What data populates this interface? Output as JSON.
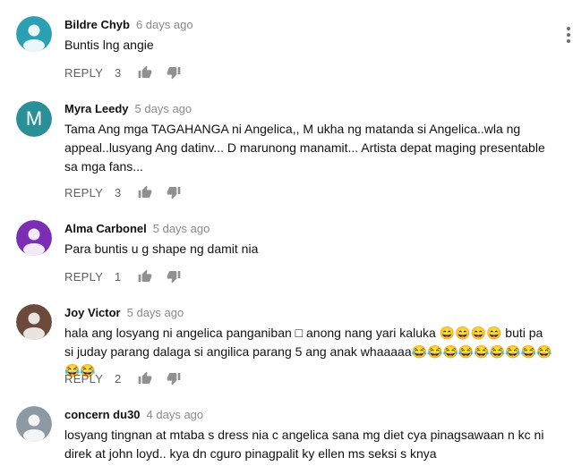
{
  "reply_label": "REPLY",
  "comments": [
    {
      "author": "Bildre Chyb",
      "time": "6 days ago",
      "text": "Buntis lng angie",
      "likes": "3",
      "avatar": {
        "type": "silhouette",
        "bg": "#2aa0b2"
      }
    },
    {
      "author": "Myra Leedy",
      "time": "5 days ago",
      "text": "Tama Ang mga TAGAHANGA ni Angelica,, M ukha ng matanda si Angelica..wla ng appeal..lusyang Ang datinv... D marunong manamit... Artista depat maging presentable sa mga fans...",
      "likes": "3",
      "avatar": {
        "type": "letter",
        "letter": "M",
        "bg": "#2a8f97"
      }
    },
    {
      "author": "Alma Carbonel",
      "time": "5 days ago",
      "text": "Para buntis u g shape ng damit nia",
      "likes": "1",
      "avatar": {
        "type": "silhouette",
        "bg": "#7b2db3"
      }
    },
    {
      "author": "Joy Victor",
      "time": "5 days ago",
      "text": "hala ang losyang ni angelica panganiban □ anong nang yari kaluka 😄😄😄😄 buti pa si juday parang dalaga si angilica parang 5 ang anak whaaaaa😂😂😂😂😂😂😂😂😂😂😂",
      "likes": "2",
      "avatar": {
        "type": "silhouette",
        "bg": "#6b4a3c"
      }
    },
    {
      "author": "concern du30",
      "time": "4 days ago",
      "text": "losyang tingnan at mtaba s dress nia c angelica sana mg diet cya pinagsawaan n kc ni direk at john loyd.. kya dn cguro pinagpalit ky ellen ms seksi s knya",
      "likes": "",
      "avatar": {
        "type": "silhouette",
        "bg": "#8e9aa3"
      }
    }
  ],
  "icons": {
    "like": "thumb-up-icon",
    "dislike": "thumb-down-icon",
    "more": "more-vert-icon"
  }
}
